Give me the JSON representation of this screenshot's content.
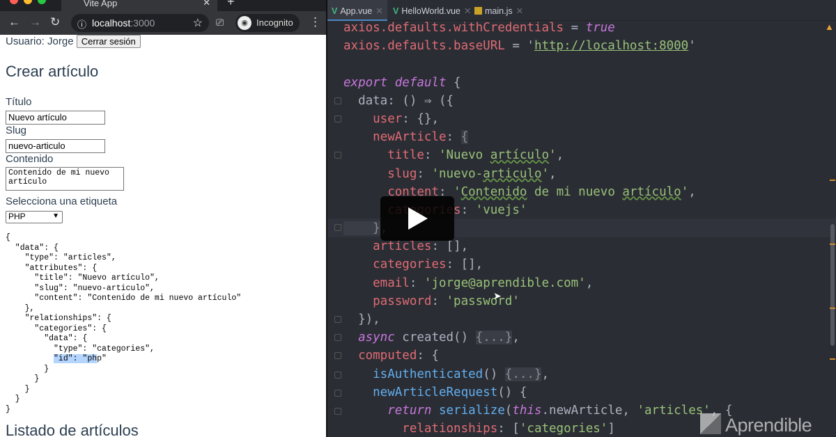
{
  "browser": {
    "tab_title": "Vite App",
    "url_host": "localhost",
    "url_port": ":3000",
    "profile": "Incognito",
    "icons": [
      "back-icon",
      "forward-icon",
      "reload-icon",
      "info-icon",
      "star-icon",
      "cast-icon",
      "incognito-icon",
      "menu-icon"
    ]
  },
  "page": {
    "user_label": "Usuario: Jorge",
    "logout_button": "Cerrar sesión",
    "heading": "Crear artículo",
    "title_label": "Título",
    "title_value": "Nuevo artículo",
    "slug_label": "Slug",
    "slug_value": "nuevo-articulo",
    "content_label": "Contenido",
    "content_value": "Contenido de mi nuevo artículo",
    "tag_label": "Selecciona una etiqueta",
    "tag_value": "PHP",
    "json_before": "{\n  \"data\": {\n    \"type\": \"articles\",\n    \"attributes\": {\n      \"title\": \"Nuevo artículo\",\n      \"slug\": \"nuevo-articulo\",\n      \"content\": \"Contenido de mi nuevo artículo\"\n    },\n    \"relationships\": {\n      \"categories\": {\n        \"data\": {\n          \"type\": \"categories\",\n          ",
    "json_selected": "\"id\": \"ph",
    "json_after": "p\"\n        }\n      }\n    }\n  }\n}",
    "list_heading": "Listado de artículos"
  },
  "editor": {
    "tabs": [
      {
        "label": "App.vue",
        "icon": "vue"
      },
      {
        "label": "HelloWorld.vue",
        "icon": "vue"
      },
      {
        "label": "main.js",
        "icon": "js"
      }
    ],
    "lines": [
      [
        [
          "prop",
          "axios.defaults.withCredentials"
        ],
        [
          "pun",
          " = "
        ],
        [
          "kw",
          "true"
        ]
      ],
      [
        [
          "prop",
          "axios.defaults.baseURL"
        ],
        [
          "pun",
          " = '"
        ],
        [
          "url",
          "http://localhost:8000"
        ],
        [
          "pun",
          "'"
        ]
      ],
      [],
      [
        [
          "kw",
          "export default"
        ],
        [
          "pun",
          " {"
        ]
      ],
      [
        [
          "pun",
          "  data: () ⇒ ({"
        ]
      ],
      [
        [
          "prop",
          "    user"
        ],
        [
          "pun",
          ": {},"
        ]
      ],
      [
        [
          "prop",
          "    newArticle"
        ],
        [
          "pun",
          ": "
        ],
        [
          "fold",
          "{"
        ]
      ],
      [
        [
          "prop",
          "      title"
        ],
        [
          "pun",
          ": "
        ],
        [
          "str",
          "'Nuevo "
        ],
        [
          "typo",
          "artículo"
        ],
        [
          "str",
          "'"
        ],
        [
          "pun",
          ","
        ]
      ],
      [
        [
          "prop",
          "      slug"
        ],
        [
          "pun",
          ": "
        ],
        [
          "str",
          "'nuevo-"
        ],
        [
          "typo",
          "articulo"
        ],
        [
          "str",
          "'"
        ],
        [
          "pun",
          ","
        ]
      ],
      [
        [
          "prop",
          "      content"
        ],
        [
          "pun",
          ": "
        ],
        [
          "str",
          "'"
        ],
        [
          "typo",
          "Contenido"
        ],
        [
          "str",
          " de mi nuevo "
        ],
        [
          "typo",
          "artículo"
        ],
        [
          "str",
          "'"
        ],
        [
          "pun",
          ","
        ]
      ],
      [
        [
          "prop",
          "      categories"
        ],
        [
          "pun",
          ": "
        ],
        [
          "str",
          "'vuejs'"
        ]
      ],
      [
        [
          "fold",
          "    }"
        ],
        [
          "pun",
          ","
        ]
      ],
      [
        [
          "prop",
          "    articles"
        ],
        [
          "pun",
          ": [],"
        ]
      ],
      [
        [
          "prop",
          "    categories"
        ],
        [
          "pun",
          ": [],"
        ]
      ],
      [
        [
          "prop",
          "    email"
        ],
        [
          "pun",
          ": "
        ],
        [
          "str",
          "'jorge@aprendible.com'"
        ],
        [
          "pun",
          ","
        ]
      ],
      [
        [
          "prop",
          "    password"
        ],
        [
          "pun",
          ": "
        ],
        [
          "str",
          "'password'"
        ]
      ],
      [
        [
          "pun",
          "  }),"
        ]
      ],
      [
        [
          "kw",
          "  async"
        ],
        [
          "pun",
          " created() "
        ],
        [
          "fold",
          "{...}"
        ],
        [
          "pun",
          ","
        ]
      ],
      [
        [
          "prop",
          "  computed"
        ],
        [
          "pun",
          ": {"
        ]
      ],
      [
        [
          "fn",
          "    isAuthenticated"
        ],
        [
          "pun",
          "() "
        ],
        [
          "fold",
          "{...}"
        ],
        [
          "pun",
          ","
        ]
      ],
      [
        [
          "fn",
          "    newArticleRequest"
        ],
        [
          "pun",
          "() {"
        ]
      ],
      [
        [
          "kw",
          "      return"
        ],
        [
          "fn",
          " serialize"
        ],
        [
          "pun",
          "("
        ],
        [
          "kw",
          "this"
        ],
        [
          "pun",
          ".newArticle, "
        ],
        [
          "str",
          "'articles'"
        ],
        [
          "pun",
          ", {"
        ]
      ],
      [
        [
          "prop",
          "        relationships"
        ],
        [
          "pun",
          ": ["
        ],
        [
          "str",
          "'categories'"
        ],
        [
          "pun",
          "]"
        ]
      ]
    ]
  },
  "watermark": "Aprendible"
}
